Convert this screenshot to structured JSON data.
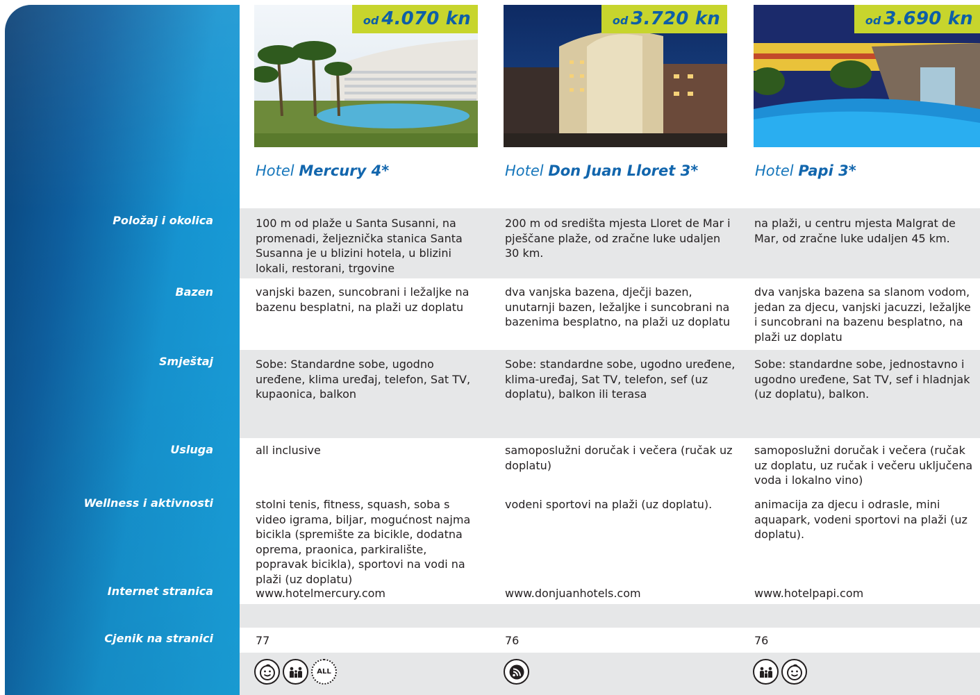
{
  "row_labels": {
    "location": "Položaj i okolica",
    "pool": "Bazen",
    "accommodation": "Smještaj",
    "service": "Usluga",
    "wellness": "Wellness i aktivnosti",
    "website": "Internet stranica",
    "price_page": "Cjenik na stranici"
  },
  "hotels": [
    {
      "price_prefix": "od",
      "price": "4.070 kn",
      "name_prefix": "Hotel",
      "name": "Mercury 4*",
      "location": "100 m od plaže u Santa Susanni, na promenadi, željeznička stanica Santa Susanna je u blizini hotela, u blizini lokali, restorani, trgovine",
      "pool": "vanjski bazen, suncobrani i ležaljke na bazenu besplatni, na plaži uz doplatu",
      "accommodation": "Sobe: Standardne sobe, ugodno uređene, klima uređaj, telefon, Sat TV, kupaonica, balkon",
      "service": "all inclusive",
      "wellness": "stolni tenis, fitness, squash, soba s video igrama, biljar, mogućnost najma bicikla (spremište za bicikle, dodatna oprema, praonica, parkiralište, popravak bicikla), sportovi na vodi na plaži (uz doplatu)",
      "website": "www.hotelmercury.com",
      "price_page": "77",
      "icons": [
        "kids-face-icon",
        "family-icon",
        "all-inclusive-icon"
      ],
      "all_inclusive_text": "ALL"
    },
    {
      "price_prefix": "od",
      "price": "3.720 kn",
      "name_prefix": "Hotel",
      "name": "Don Juan Lloret 3*",
      "location": "200 m od središta mjesta Lloret de Mar i pješčane plaže, od zračne luke udaljen 30 km.",
      "pool": "dva vanjska bazena, dječji bazen, unutarnji bazen, ležaljke i suncobrani na bazenima besplatno, na plaži uz doplatu",
      "accommodation": "Sobe: standardne sobe, ugodno uređene, klima-uređaj, Sat TV, telefon, sef (uz doplatu), balkon ili terasa",
      "service": "samoposlužni doručak i večera (ručak uz doplatu)",
      "wellness": "vodeni sportovi na plaži (uz doplatu).",
      "website": "www.donjuanhotels.com",
      "price_page": "76",
      "icons": [
        "wifi-icon"
      ]
    },
    {
      "price_prefix": "od",
      "price": "3.690 kn",
      "name_prefix": "Hotel",
      "name": "Papi 3*",
      "location": "na plaži, u centru mjesta Malgrat de Mar, od zračne luke udaljen 45 km.",
      "pool": "dva vanjska bazena sa slanom vodom, jedan za djecu, vanjski jacuzzi, ležaljke i suncobrani na bazenu besplatno, na plaži uz doplatu",
      "accommodation": "Sobe: standardne sobe, jednostavno i ugodno uređene, Sat TV, sef i hladnjak (uz doplatu), balkon.",
      "service": "samoposlužni doručak i večera (ručak uz doplatu, uz ručak i večeru uključena voda i lokalno vino)",
      "wellness": "animacija za djecu i odrasle, mini aquapark, vodeni sportovi na plaži (uz doplatu).",
      "website": "www.hotelpapi.com",
      "price_page": "76",
      "icons": [
        "family-icon",
        "kids-face-icon"
      ]
    }
  ],
  "colors": {
    "band": "#e6e7e8",
    "sidebar_dark": "#0a3f74",
    "sidebar_light": "#1aa3de",
    "price_tag": "#c7d52d",
    "price_text": "#0e5fa6",
    "hotel_name": "#1676bb"
  }
}
